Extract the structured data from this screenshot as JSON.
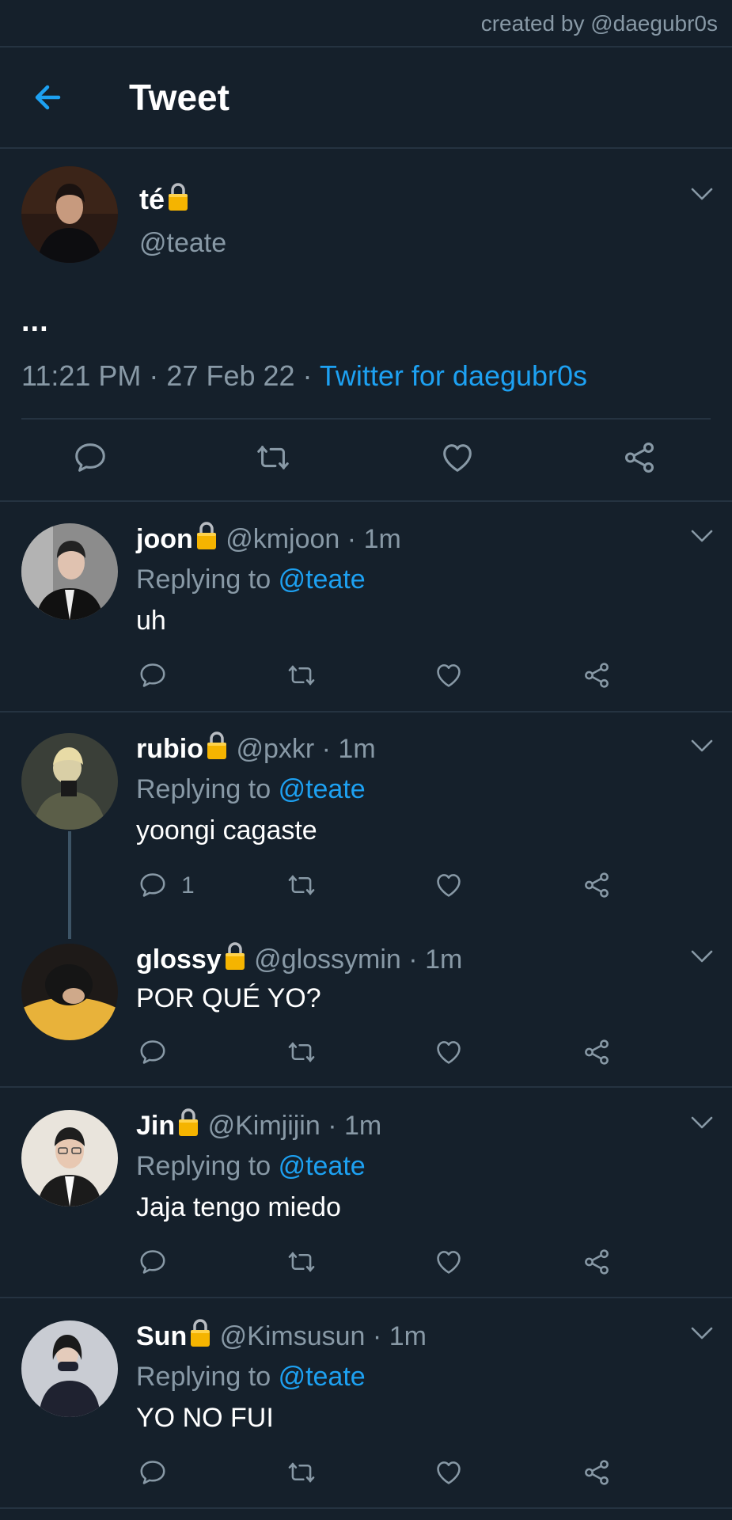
{
  "credit": "created by @daegubr0s",
  "header": {
    "title": "Tweet"
  },
  "main_tweet": {
    "name": "té",
    "handle": "@teate",
    "text": "...",
    "time": "11:21 PM",
    "date": "27 Feb 22",
    "source": "Twitter for daegubr0s"
  },
  "replies": [
    {
      "name": "joon",
      "handle": "@kmjoon",
      "time": "1m",
      "replying_prefix": "Replying to",
      "replying_to": "@teate",
      "text": "uh"
    },
    {
      "name": "rubio",
      "handle": "@pxkr",
      "time": "1m",
      "replying_prefix": "Replying to",
      "replying_to": "@teate",
      "text": "yoongi cagaste",
      "reply_count": "1"
    },
    {
      "name": "glossy",
      "handle": "@glossymin",
      "time": "1m",
      "text": "POR QUÉ YO?"
    },
    {
      "name": "Jin",
      "handle": "@Kimjijin",
      "time": "1m",
      "replying_prefix": "Replying to",
      "replying_to": "@teate",
      "text": "Jaja tengo miedo"
    },
    {
      "name": "Sun",
      "handle": "@Kimsusun",
      "time": "1m",
      "replying_prefix": "Replying to",
      "replying_to": "@teate",
      "text": "YO NO FUI"
    }
  ],
  "separator": " · ",
  "icons": {
    "back": "arrow-left-icon",
    "more": "chevron-down-icon",
    "lock": "lock-icon",
    "reply": "reply-icon",
    "retweet": "retweet-icon",
    "like": "heart-icon",
    "share": "share-icon"
  },
  "colors": {
    "background": "#15202b",
    "divider": "#253341",
    "secondary_text": "#8899a6",
    "accent": "#1da1f2",
    "lock": "#f5b400"
  }
}
